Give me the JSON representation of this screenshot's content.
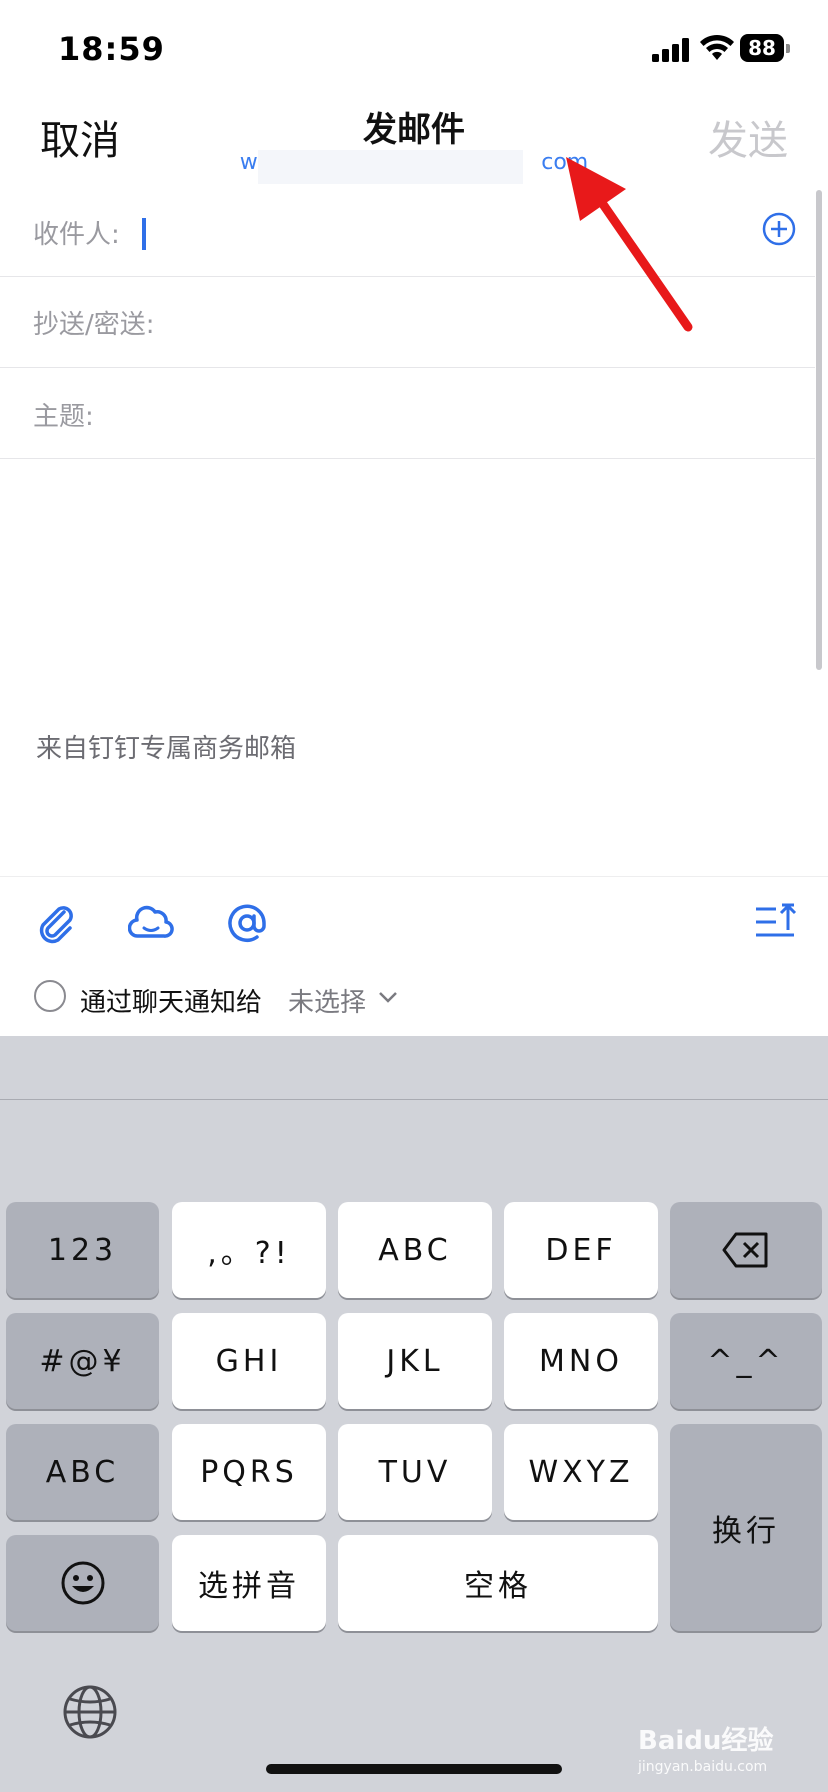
{
  "status_bar": {
    "time": "18:59",
    "battery": "88"
  },
  "nav": {
    "cancel_label": "取消",
    "title": "发邮件",
    "sender_prefix": "wa",
    "sender_suffix": "com",
    "send_label": "发送"
  },
  "fields": {
    "to_label": "收件人:",
    "cc_label": "抄送/密送:",
    "subject_label": "主题:"
  },
  "body": {
    "signature": "来自钉钉专属商务邮箱"
  },
  "toolbar": {
    "attach_icon": "paperclip-icon",
    "cloud_icon": "cloud-icon",
    "mention_icon": "at-icon",
    "expand_icon": "collapse-keyboard-icon"
  },
  "notify": {
    "label": "通过聊天通知给",
    "value": "未选择"
  },
  "keyboard": {
    "row1": [
      "123",
      ",。?!",
      "ABC",
      "DEF"
    ],
    "row2": [
      "#@¥",
      "GHI",
      "JKL",
      "MNO",
      "^_^"
    ],
    "row3": [
      "ABC",
      "PQRS",
      "TUV",
      "WXYZ"
    ],
    "row4_mid": [
      "选拼音",
      "空格"
    ],
    "return_label": "换行",
    "delete_icon": "backspace-icon",
    "emoji_icon": "smiley-icon",
    "globe_icon": "globe-icon"
  },
  "watermark": {
    "brand": "Baidu经验",
    "url": "jingyan.baidu.com"
  },
  "colors": {
    "accent": "#2f6fe8",
    "send_disabled": "#c8c8cc",
    "keyboard_bg": "#d1d3d9",
    "arrow": "#e8191a"
  }
}
